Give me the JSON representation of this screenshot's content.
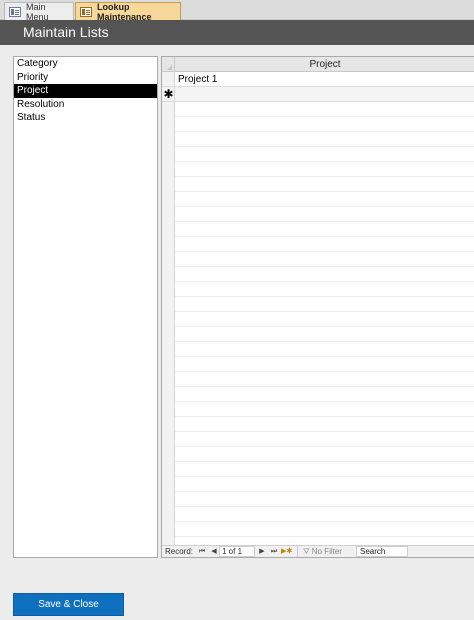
{
  "tabs": [
    {
      "label": "Main Menu",
      "active": false
    },
    {
      "label": "Lookup Maintenance",
      "active": true
    }
  ],
  "header": {
    "title": "Maintain Lists"
  },
  "list": {
    "items": [
      "Category",
      "Priority",
      "Project",
      "Resolution",
      "Status"
    ],
    "selected": "Project"
  },
  "datasheet": {
    "column_header": "Project",
    "rows": [
      "Project 1"
    ],
    "new_record_marker": "✱"
  },
  "navigation": {
    "record_label": "Record:",
    "position": "1 of 1",
    "filter_label": "No Filter",
    "search_placeholder": "Search"
  },
  "buttons": {
    "save_close": "Save & Close"
  },
  "colors": {
    "header_bg": "#545454",
    "active_tab": "#f7d79a",
    "selection": "#000000",
    "button": "#1070c0"
  },
  "icons": [
    "form-tab-icon",
    "first-record-icon",
    "previous-record-icon",
    "next-record-icon",
    "last-record-icon",
    "new-record-icon",
    "filter-icon"
  ]
}
